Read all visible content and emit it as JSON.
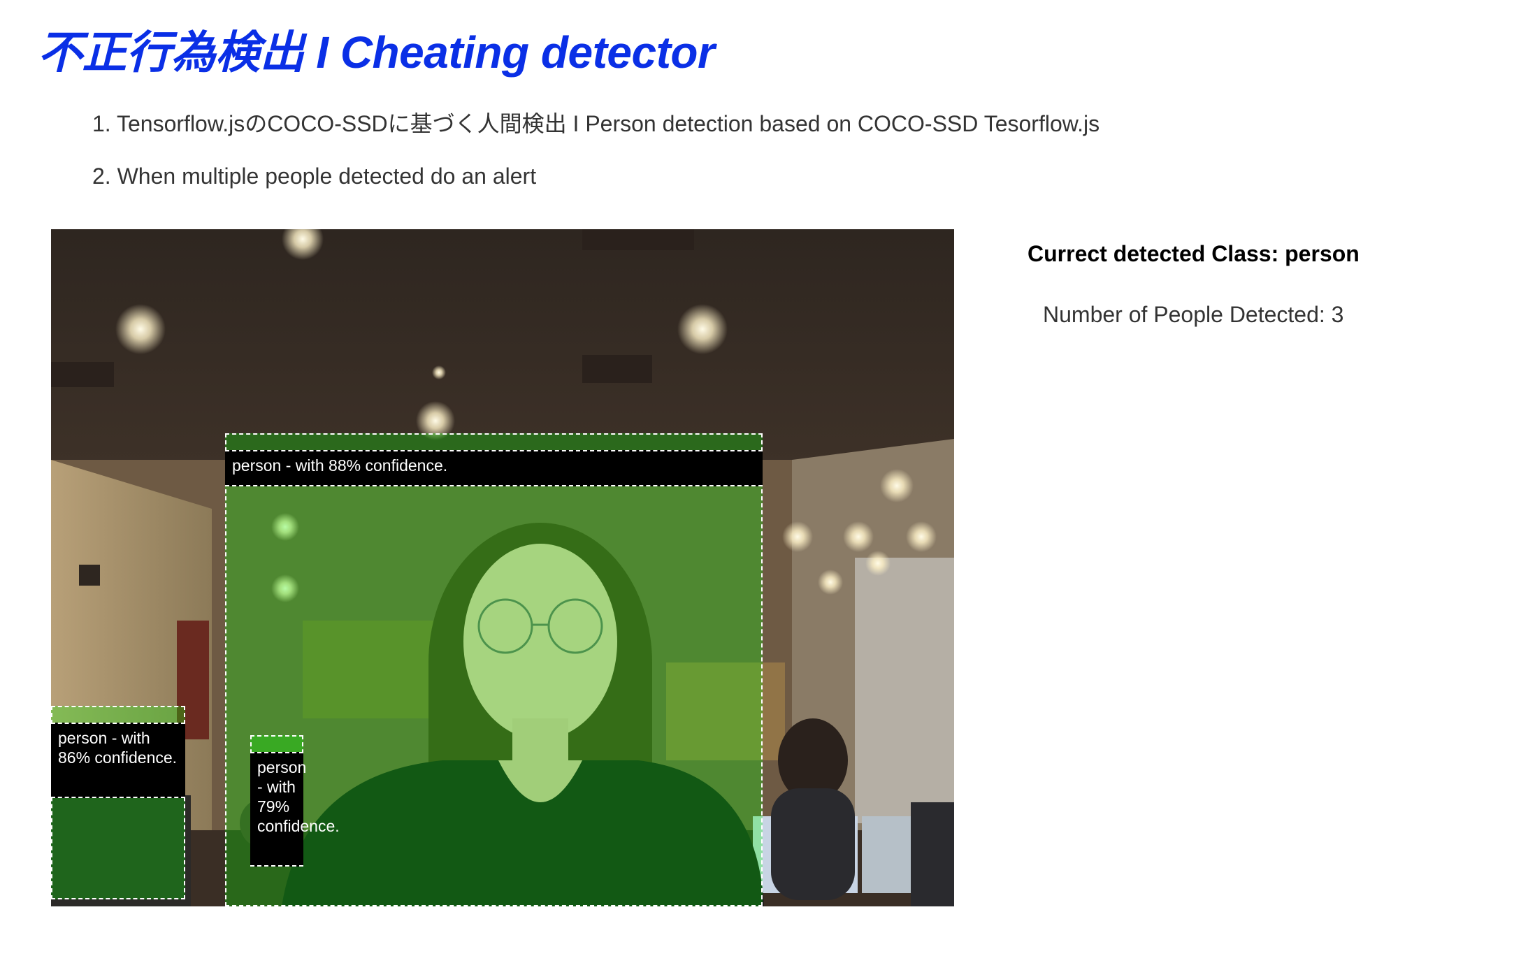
{
  "page": {
    "title": "不正行為検出 I Cheating detector"
  },
  "steps": [
    "1. Tensorflow.jsのCOCO-SSDに基づく人間検出 I Person detection based on COCO-SSD Tesorflow.js",
    "2. When multiple people detected do an alert"
  ],
  "detections": [
    {
      "label": "person - with 88% confidence."
    },
    {
      "label": "person - with 86% confidence."
    },
    {
      "label": "person - with 79% confidence."
    }
  ],
  "status": {
    "class_heading": "Currect detected Class: person",
    "people_count": "Number of People Detected: 3"
  },
  "colors": {
    "title": "#0a2fe6",
    "box_overlay": "rgba(0,255,0,0.28)",
    "label_background": "#000000",
    "label_text": "#ffffff"
  },
  "icons": {
    "webcam_feed": "camera-feed-image"
  }
}
